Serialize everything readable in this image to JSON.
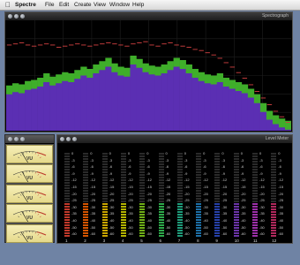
{
  "menubar": {
    "app": "Spectre",
    "items": [
      "File",
      "Edit",
      "Create",
      "View",
      "Window",
      "Help"
    ]
  },
  "spectrum_window": {
    "title": "Spectrograph",
    "levels": [
      0.33,
      0.35,
      0.34,
      0.37,
      0.38,
      0.4,
      0.44,
      0.41,
      0.43,
      0.45,
      0.44,
      0.47,
      0.5,
      0.48,
      0.52,
      0.55,
      0.58,
      0.53,
      0.5,
      0.49,
      0.6,
      0.57,
      0.53,
      0.51,
      0.5,
      0.52,
      0.55,
      0.58,
      0.56,
      0.52,
      0.48,
      0.45,
      0.43,
      0.42,
      0.44,
      0.4,
      0.38,
      0.36,
      0.34,
      0.3,
      0.25,
      0.17,
      0.1,
      0.06,
      0.03,
      0.01
    ],
    "peaks": [
      0.78,
      0.79,
      0.8,
      0.78,
      0.77,
      0.78,
      0.79,
      0.78,
      0.76,
      0.77,
      0.78,
      0.79,
      0.78,
      0.77,
      0.78,
      0.79,
      0.8,
      0.79,
      0.78,
      0.77,
      0.79,
      0.8,
      0.81,
      0.78,
      0.77,
      0.79,
      0.8,
      0.78,
      0.77,
      0.76,
      0.74,
      0.73,
      0.71,
      0.69,
      0.66,
      0.62,
      0.58,
      0.53,
      0.48,
      0.42,
      0.36,
      0.3,
      0.24,
      0.18,
      0.13,
      0.08
    ]
  },
  "vu_window": {
    "meters": [
      {
        "label": "VU",
        "needle": -32
      },
      {
        "label": "VU",
        "needle": -30
      },
      {
        "label": "VU",
        "needle": -33
      },
      {
        "label": "VU",
        "needle": -31
      },
      {
        "label": "VU",
        "needle": -34
      }
    ]
  },
  "level_window": {
    "title": "Level Meter",
    "scale": [
      "0",
      "-3",
      "-6",
      "-9",
      "-12",
      "-15",
      "-20",
      "-25",
      "-30",
      "-35",
      "-40",
      "-50",
      "-60"
    ],
    "channels": [
      {
        "label": "1",
        "color": "#c0392b",
        "level": 0.42
      },
      {
        "label": "2",
        "color": "#d35400",
        "level": 0.42
      },
      {
        "label": "3",
        "color": "#c8a400",
        "level": 0.4
      },
      {
        "label": "4",
        "color": "#b3b300",
        "level": 0.42
      },
      {
        "label": "5",
        "color": "#6fae17",
        "level": 0.42
      },
      {
        "label": "6",
        "color": "#2ea84a",
        "level": 0.42
      },
      {
        "label": "7",
        "color": "#1f9b7a",
        "level": 0.42
      },
      {
        "label": "8",
        "color": "#1d6fa6",
        "level": 0.41
      },
      {
        "label": "9",
        "color": "#2640a8",
        "level": 0.41
      },
      {
        "label": "10",
        "color": "#6a34a8",
        "level": 0.4
      },
      {
        "label": "11",
        "color": "#9b2fa8",
        "level": 0.42
      },
      {
        "label": "12",
        "color": "#b0285c",
        "level": 0.42
      }
    ]
  }
}
